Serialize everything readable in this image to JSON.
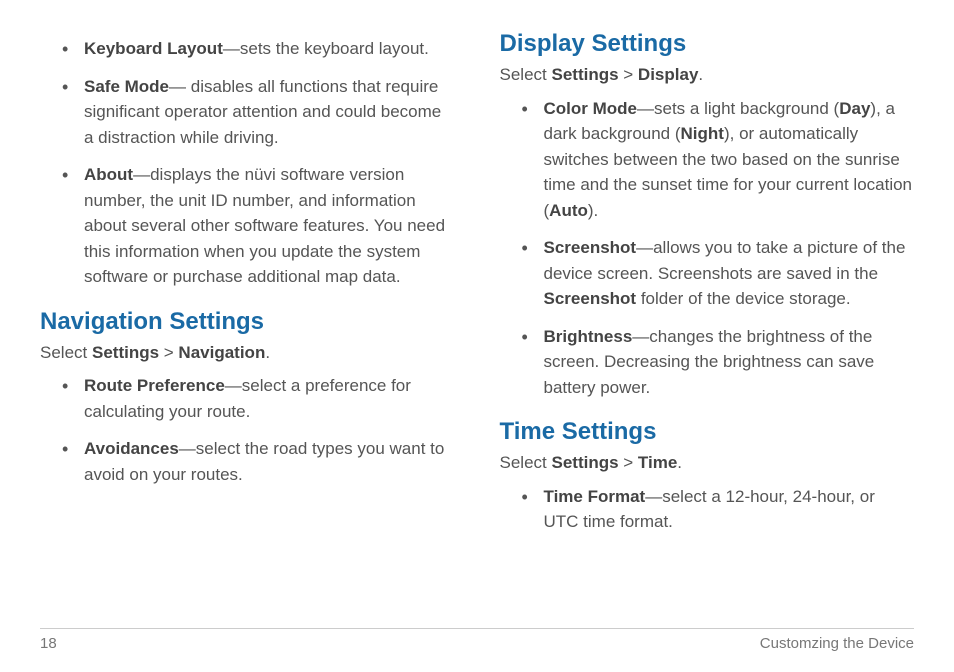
{
  "leftCol": {
    "topBullets": [
      {
        "term": "Keyboard Layout",
        "text": "—sets the keyboard layout."
      },
      {
        "term": "Safe Mode",
        "text": "— disables all functions that require significant operator attention and could become a distraction while driving."
      },
      {
        "term": "About",
        "text": "—displays the nüvi software version number, the unit ID number, and information about several other software features. You need this information when you update the system software or purchase additional map data."
      }
    ],
    "navHeading": "Navigation Settings",
    "navCrumb": {
      "pre": "Select ",
      "a": "Settings",
      "sep": " > ",
      "b": "Navigation",
      "post": "."
    },
    "navBullets": [
      {
        "term": "Route Preference",
        "text": "—select a preference for calculating your route."
      },
      {
        "term": "Avoidances",
        "text": "—select the road types you want to avoid on your routes."
      }
    ]
  },
  "rightCol": {
    "dispHeading": "Display Settings",
    "dispCrumb": {
      "pre": "Select ",
      "a": "Settings",
      "sep": " > ",
      "b": "Display",
      "post": "."
    },
    "dispBullets": {
      "color": {
        "term": "Color Mode",
        "seg1": "—sets a light background (",
        "day": "Day",
        "seg2": "), a dark background (",
        "night": "Night",
        "seg3": "), or automatically switches between the two based on the sunrise time and the sunset time for your current location (",
        "auto": "Auto",
        "seg4": ")."
      },
      "screenshot": {
        "term": "Screenshot",
        "seg1": "—allows you to take a picture of the device screen. Screenshots are saved in the ",
        "folder": "Screenshot",
        "seg2": " folder of the device storage."
      },
      "brightness": {
        "term": "Brightness",
        "text": "—changes the brightness of the screen. Decreasing the brightness can save battery power."
      }
    },
    "timeHeading": "Time Settings",
    "timeCrumb": {
      "pre": "Select ",
      "a": "Settings",
      "sep": " > ",
      "b": "Time",
      "post": "."
    },
    "timeBullets": [
      {
        "term": "Time Format",
        "text": "—select a 12-hour, 24-hour, or UTC time format."
      }
    ]
  },
  "footer": {
    "page": "18",
    "title": "Customzing the Device"
  }
}
